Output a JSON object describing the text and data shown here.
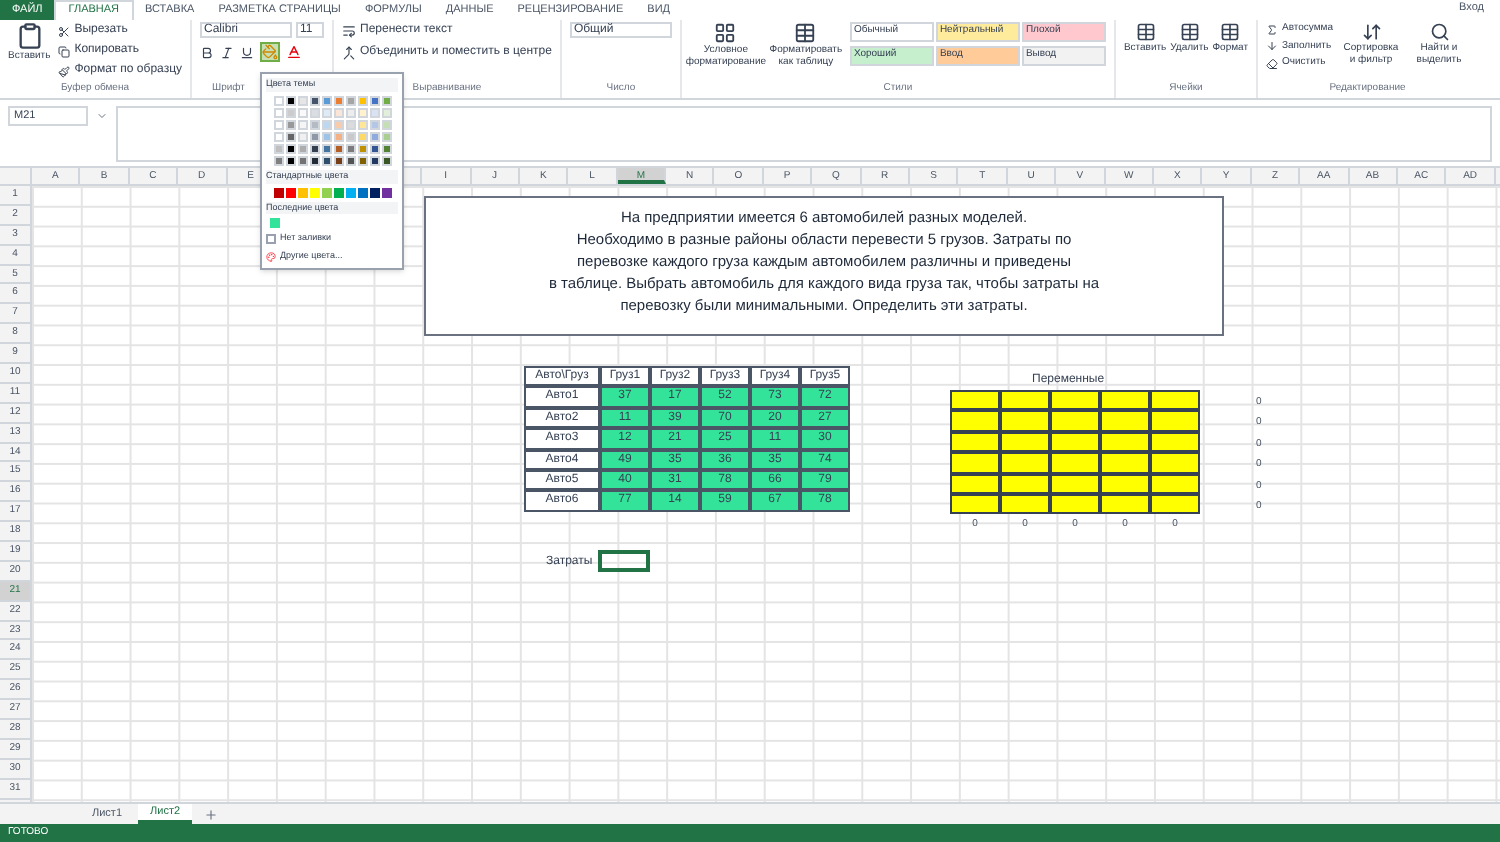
{
  "ribbon": {
    "tabs": [
      {
        "label": "ФАЙЛ",
        "kind": "file",
        "selected": false
      },
      {
        "label": "ГЛАВНАЯ",
        "kind": "tab",
        "selected": true
      },
      {
        "label": "ВСТАВКА",
        "kind": "tab",
        "selected": false
      },
      {
        "label": "РАЗМЕТКА СТРАНИЦЫ",
        "kind": "tab",
        "selected": false
      },
      {
        "label": "ФОРМУЛЫ",
        "kind": "tab",
        "selected": false
      },
      {
        "label": "ДАННЫЕ",
        "kind": "tab",
        "selected": false
      },
      {
        "label": "РЕЦЕНЗИРОВАНИЕ",
        "kind": "tab",
        "selected": false
      },
      {
        "label": "ВИД",
        "kind": "tab",
        "selected": false
      }
    ],
    "account": "Вход",
    "clipboard": {
      "label": "Буфер обмена",
      "paste": "Вставить",
      "items": [
        "Вырезать",
        "Копировать",
        "Формат по образцу"
      ]
    },
    "font": {
      "label": "Шрифт",
      "name": "Calibri",
      "size": "11"
    },
    "alignment": {
      "label": "Выравнивание",
      "items": [
        "Перенести текст",
        "Объединить и поместить в центре"
      ]
    },
    "number": {
      "label": "Число",
      "format": "Общий"
    },
    "styles": {
      "label": "Стили",
      "buttons": [
        "Условное форматирование",
        "Форматировать как таблицу"
      ],
      "cells": [
        {
          "label": "Обычный",
          "color": "#ffffff"
        },
        {
          "label": "Нейтральный",
          "color": "#ffeb9c"
        },
        {
          "label": "Плохой",
          "color": "#ffc7ce"
        },
        {
          "label": "Хороший",
          "color": "#c6efce"
        },
        {
          "label": "Ввод",
          "color": "#ffcc99"
        },
        {
          "label": "Вывод",
          "color": "#f2f2f2"
        }
      ]
    },
    "cells": {
      "label": "Ячейки",
      "buttons": [
        "Вставить",
        "Удалить",
        "Формат"
      ]
    },
    "editing": {
      "label": "Редактирование",
      "items": [
        "Автосумма",
        "Заполнить",
        "Очистить"
      ],
      "buttons": [
        "Сортировка и фильтр",
        "Найти и выделить"
      ]
    }
  },
  "color_menu": {
    "theme_title": "Цвета темы",
    "theme": [
      {
        "color": "#ffffff"
      },
      {
        "color": "#000000"
      },
      {
        "color": "#e7e6e6"
      },
      {
        "color": "#44546a"
      },
      {
        "color": "#5b9bd5"
      },
      {
        "color": "#ed7d31"
      },
      {
        "color": "#a5a5a5"
      },
      {
        "color": "#ffc000"
      },
      {
        "color": "#4472c4"
      },
      {
        "color": "#70ad47"
      }
    ],
    "standard_title": "Стандартные цвета",
    "standard": [
      {
        "color": "#c00000"
      },
      {
        "color": "#ff0000"
      },
      {
        "color": "#ffc000"
      },
      {
        "color": "#ffff00"
      },
      {
        "color": "#92d050"
      },
      {
        "color": "#00b050"
      },
      {
        "color": "#00b0f0"
      },
      {
        "color": "#0070c0"
      },
      {
        "color": "#002060"
      },
      {
        "color": "#7030a0"
      }
    ],
    "recent_title": "Последние цвета",
    "recent": [
      {
        "color": "#33e39a"
      }
    ],
    "no_fill": "Нет заливки",
    "more": "Другие цвета..."
  },
  "formula_bar": {
    "name_box": "M21"
  },
  "sheet": {
    "columns_left": [
      {
        "label": "A",
        "selected": false
      },
      {
        "label": "B",
        "selected": false
      },
      {
        "label": "C",
        "selected": false
      },
      {
        "label": "D",
        "selected": false
      },
      {
        "label": "E",
        "selected": false
      }
    ],
    "columns_right": [
      {
        "label": "I",
        "selected": false
      },
      {
        "label": "J",
        "selected": false
      },
      {
        "label": "K",
        "selected": false
      },
      {
        "label": "L",
        "selected": false
      },
      {
        "label": "M",
        "selected": true
      },
      {
        "label": "N",
        "selected": false
      },
      {
        "label": "O",
        "selected": false
      },
      {
        "label": "P",
        "selected": false
      },
      {
        "label": "Q",
        "selected": false
      },
      {
        "label": "R",
        "selected": false
      },
      {
        "label": "S",
        "selected": false
      },
      {
        "label": "T",
        "selected": false
      },
      {
        "label": "U",
        "selected": false
      },
      {
        "label": "V",
        "selected": false
      },
      {
        "label": "W",
        "selected": false
      },
      {
        "label": "X",
        "selected": false
      },
      {
        "label": "Y",
        "selected": false
      },
      {
        "label": "Z",
        "selected": false
      },
      {
        "label": "AA",
        "selected": false
      },
      {
        "label": "AB",
        "selected": false
      },
      {
        "label": "AC",
        "selected": false
      },
      {
        "label": "AD",
        "selected": false
      }
    ],
    "rows": [
      {
        "label": "1",
        "selected": false
      },
      {
        "label": "2",
        "selected": false
      },
      {
        "label": "3",
        "selected": false
      },
      {
        "label": "4",
        "selected": false
      },
      {
        "label": "5",
        "selected": false
      },
      {
        "label": "6",
        "selected": false
      },
      {
        "label": "7",
        "selected": false
      },
      {
        "label": "8",
        "selected": false
      },
      {
        "label": "9",
        "selected": false
      },
      {
        "label": "10",
        "selected": false
      },
      {
        "label": "11",
        "selected": false
      },
      {
        "label": "12",
        "selected": false
      },
      {
        "label": "13",
        "selected": false
      },
      {
        "label": "14",
        "selected": false
      },
      {
        "label": "15",
        "selected": false
      },
      {
        "label": "16",
        "selected": false
      },
      {
        "label": "17",
        "selected": false
      },
      {
        "label": "18",
        "selected": false
      },
      {
        "label": "19",
        "selected": false
      },
      {
        "label": "20",
        "selected": false
      },
      {
        "label": "21",
        "selected": true
      },
      {
        "label": "22",
        "selected": false
      },
      {
        "label": "23",
        "selected": false
      },
      {
        "label": "24",
        "selected": false
      },
      {
        "label": "25",
        "selected": false
      },
      {
        "label": "26",
        "selected": false
      },
      {
        "label": "27",
        "selected": false
      },
      {
        "label": "28",
        "selected": false
      },
      {
        "label": "29",
        "selected": false
      },
      {
        "label": "30",
        "selected": false
      },
      {
        "label": "31",
        "selected": false
      }
    ],
    "text_box": {
      "lines": [
        "На предприятии имеется 6 автомобилей разных моделей.",
        "Необходимо в разные районы области перевести 5 грузов. Затраты по",
        "перевозке каждого груза каждым автомобилем различны и приведены",
        "в таблице. Выбрать автомобиль для каждого вида груза так, чтобы затраты на",
        "перевозку были минимальными. Определить эти затраты."
      ]
    },
    "cost_table": {
      "header": [
        "Авто\\Груз",
        "Груз1",
        "Груз2",
        "Груз3",
        "Груз4",
        "Груз5"
      ],
      "rows": [
        {
          "name": "Авто1",
          "values": [
            "37",
            "17",
            "52",
            "73",
            "72"
          ]
        },
        {
          "name": "Авто2",
          "values": [
            "11",
            "39",
            "70",
            "20",
            "27"
          ]
        },
        {
          "name": "Авто3",
          "values": [
            "12",
            "21",
            "25",
            "11",
            "30"
          ]
        },
        {
          "name": "Авто4",
          "values": [
            "49",
            "35",
            "36",
            "35",
            "74"
          ]
        },
        {
          "name": "Авто5",
          "values": [
            "40",
            "31",
            "78",
            "66",
            "79"
          ]
        },
        {
          "name": "Авто6",
          "values": [
            "77",
            "14",
            "59",
            "67",
            "78"
          ]
        }
      ]
    },
    "variables": {
      "title": "Переменные",
      "row_sums": [
        "0",
        "0",
        "0",
        "0",
        "0",
        "0"
      ],
      "col_sums": [
        "0",
        "0",
        "0",
        "0",
        "0"
      ]
    },
    "cost": {
      "label": "Затраты"
    }
  },
  "sheet_tabs": [
    {
      "label": "Лист1",
      "selected": false
    },
    {
      "label": "Лист2",
      "selected": true
    }
  ],
  "status_bar": {
    "text": "ГОТОВО"
  }
}
